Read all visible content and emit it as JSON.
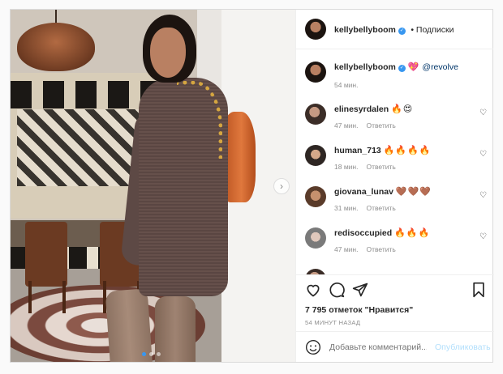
{
  "post": {
    "author": "kellybellyboom",
    "follow_label": "• Подписки",
    "caption": {
      "emoji": "💖",
      "mention": "@revolve",
      "time": "54 мин."
    },
    "comments": [
      {
        "username": "elinesyrdalen",
        "text": "🔥😍",
        "time": "47 мин.",
        "reply": "Ответить"
      },
      {
        "username": "human_713",
        "text": "🔥🔥🔥🔥",
        "time": "18 мин.",
        "reply": "Ответить"
      },
      {
        "username": "giovana_lunav",
        "text": "🤎🤎🤎",
        "time": "31 мин.",
        "reply": "Ответить"
      },
      {
        "username": "redisoccupied",
        "text": "🔥🔥🔥",
        "time": "47 мин.",
        "reply": "Ответить"
      }
    ],
    "likes": "7 795 отметок \"Нравится\"",
    "posted_ago": "54 МИНУТ НАЗАД",
    "comment_placeholder": "Добавьте комментарий...",
    "publish_label": "Опубликовать",
    "icons": {
      "like": "heart-icon",
      "comment": "comment-icon",
      "share": "share-icon",
      "save": "bookmark-icon",
      "emoji": "smiley-icon",
      "next": "chevron-right-icon",
      "verified": "verified-badge-icon"
    },
    "carousel": {
      "slides": 3,
      "active": 1
    }
  }
}
